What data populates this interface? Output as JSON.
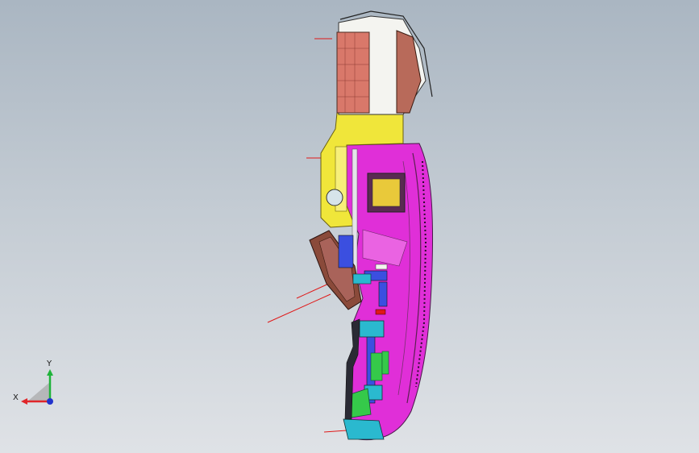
{
  "viewport": {
    "background_top": "#aab6c2",
    "background_bottom": "#dfe2e6"
  },
  "axis_triad": {
    "x_label": "X",
    "y_label": "Y",
    "x_color": "#e0262a",
    "y_color": "#1fb33a",
    "z_color": "#2233cc"
  },
  "model": {
    "colors": {
      "magenta_shell": "#e02fd8",
      "yellow_frame": "#f0e63a",
      "salmon_panel": "#d9786a",
      "white_panel": "#f4f4f0",
      "cyan_parts": "#2ab9cf",
      "green_parts": "#35c94a",
      "blue_parts": "#3b4fe0",
      "brown_parts": "#8a4a3a",
      "red_callout": "#e01818"
    }
  }
}
